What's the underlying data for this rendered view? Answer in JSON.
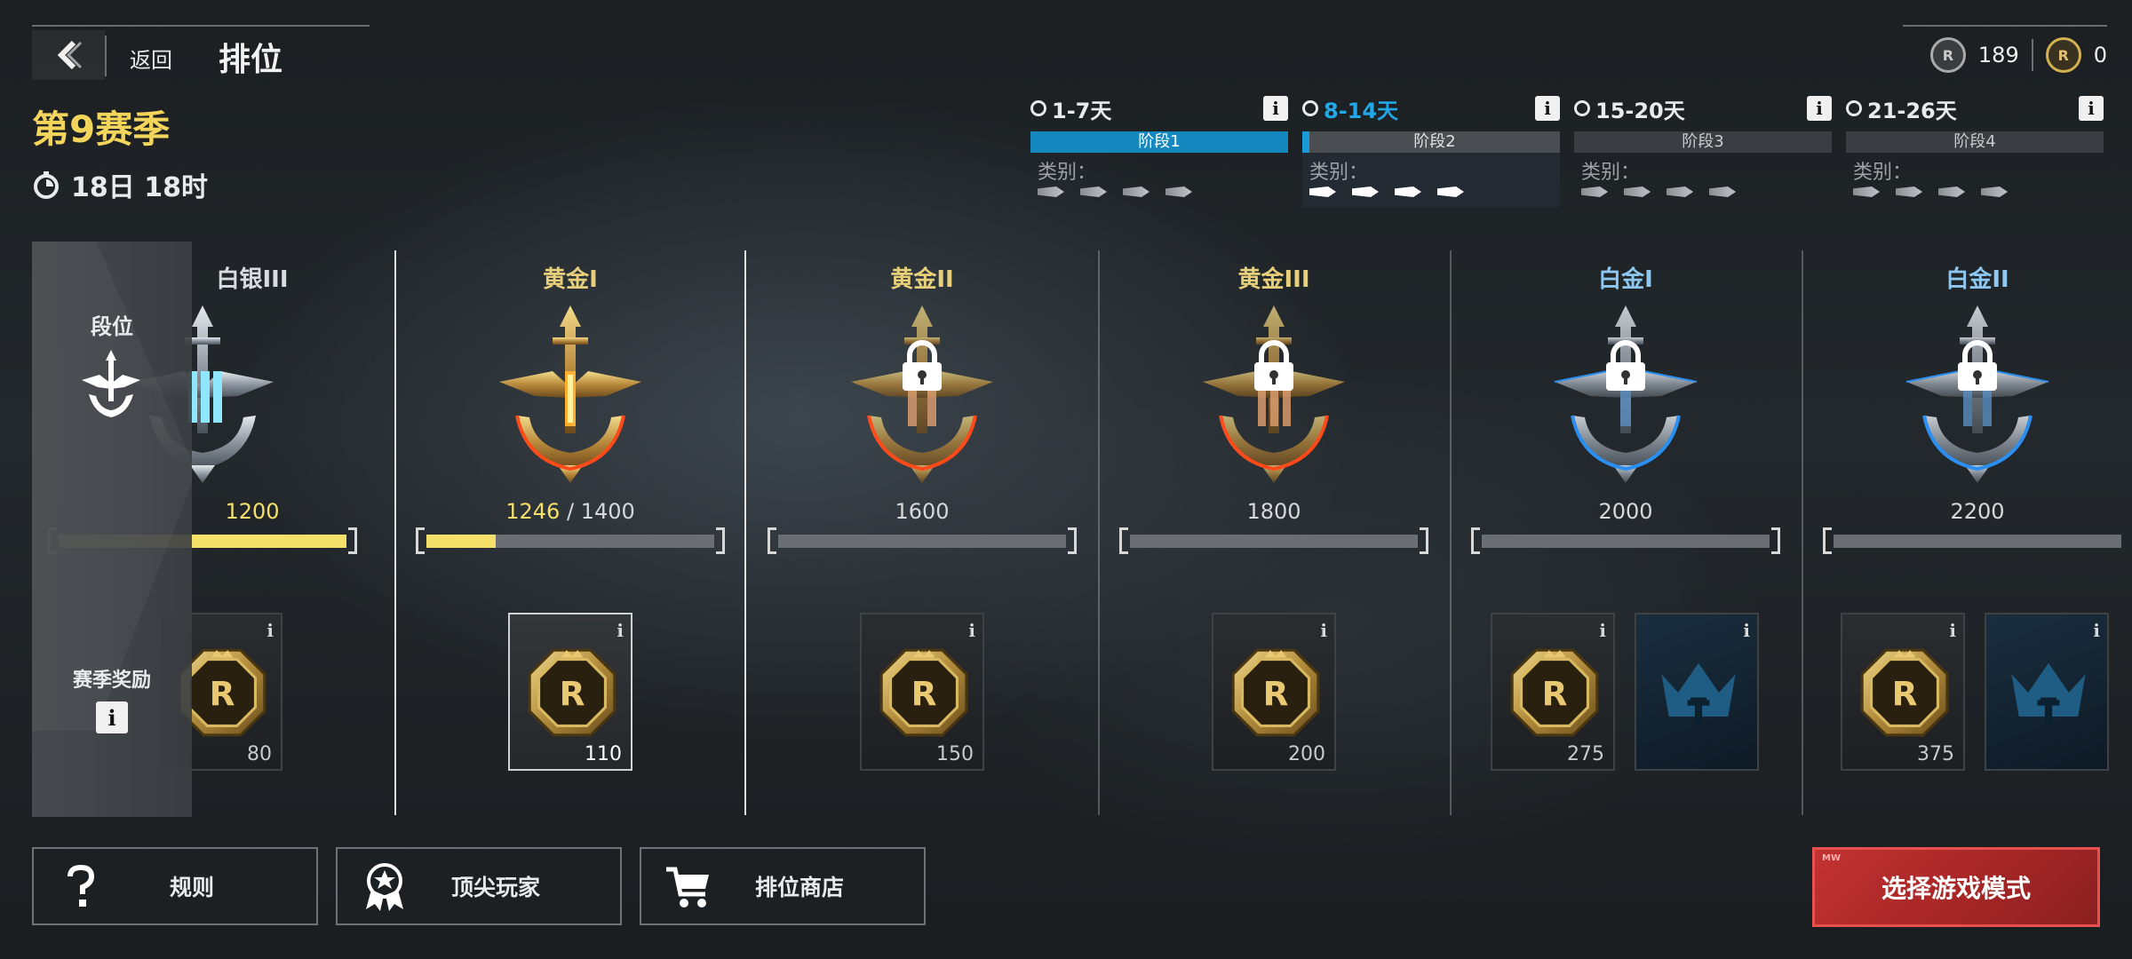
{
  "header": {
    "back_label": "返回",
    "title": "排位"
  },
  "season": {
    "title": "第9赛季",
    "timer": "18日 18时"
  },
  "currency": {
    "silver_value": "189",
    "gold_value": "0"
  },
  "stages": [
    {
      "days": "1-7天",
      "name": "阶段1",
      "category_label": "类别："
    },
    {
      "days": "8-14天",
      "name": "阶段2",
      "category_label": "类别："
    },
    {
      "days": "15-20天",
      "name": "阶段3",
      "category_label": "类别："
    },
    {
      "days": "21-26天",
      "name": "阶段4",
      "category_label": "类别："
    }
  ],
  "side_panel": {
    "rank_label": "段位",
    "reward_label": "赛季奖励"
  },
  "ranks": [
    {
      "name": "白银III",
      "tier": "silver",
      "score": "1200",
      "progress": 1.0,
      "rewards": [
        {
          "amount": "80"
        }
      ]
    },
    {
      "name": "黄金I",
      "tier": "gold",
      "score": "1400",
      "current_score": "1246",
      "progress": 0.24,
      "rewards": [
        {
          "amount": "110"
        }
      ]
    },
    {
      "name": "黄金II",
      "tier": "gold",
      "score": "1600",
      "progress": 0,
      "locked": true,
      "rewards": [
        {
          "amount": "150"
        }
      ]
    },
    {
      "name": "黄金III",
      "tier": "gold",
      "score": "1800",
      "progress": 0,
      "locked": true,
      "rewards": [
        {
          "amount": "200"
        }
      ]
    },
    {
      "name": "白金I",
      "tier": "plat",
      "score": "2000",
      "progress": 0,
      "locked": true,
      "rewards": [
        {
          "amount": "275"
        },
        {
          "amount": ""
        }
      ]
    },
    {
      "name": "白金II",
      "tier": "plat",
      "score": "2200",
      "progress": 0,
      "locked": true,
      "rewards": [
        {
          "amount": "375"
        },
        {
          "amount": ""
        }
      ]
    }
  ],
  "score_separator": "/",
  "buttons": {
    "rules": "规则",
    "top_players": "顶尖玩家",
    "ranked_shop": "排位商店",
    "select_mode": "选择游戏模式",
    "select_mode_tag": "MW"
  },
  "icons": {
    "info": "i",
    "coin_letter": "R",
    "plat_letter": "T"
  },
  "colors": {
    "accent_gold": "#f3d55b",
    "accent_blue": "#1688c0",
    "play_red": "#c33232",
    "progress_yellow": "#f5e06a"
  }
}
